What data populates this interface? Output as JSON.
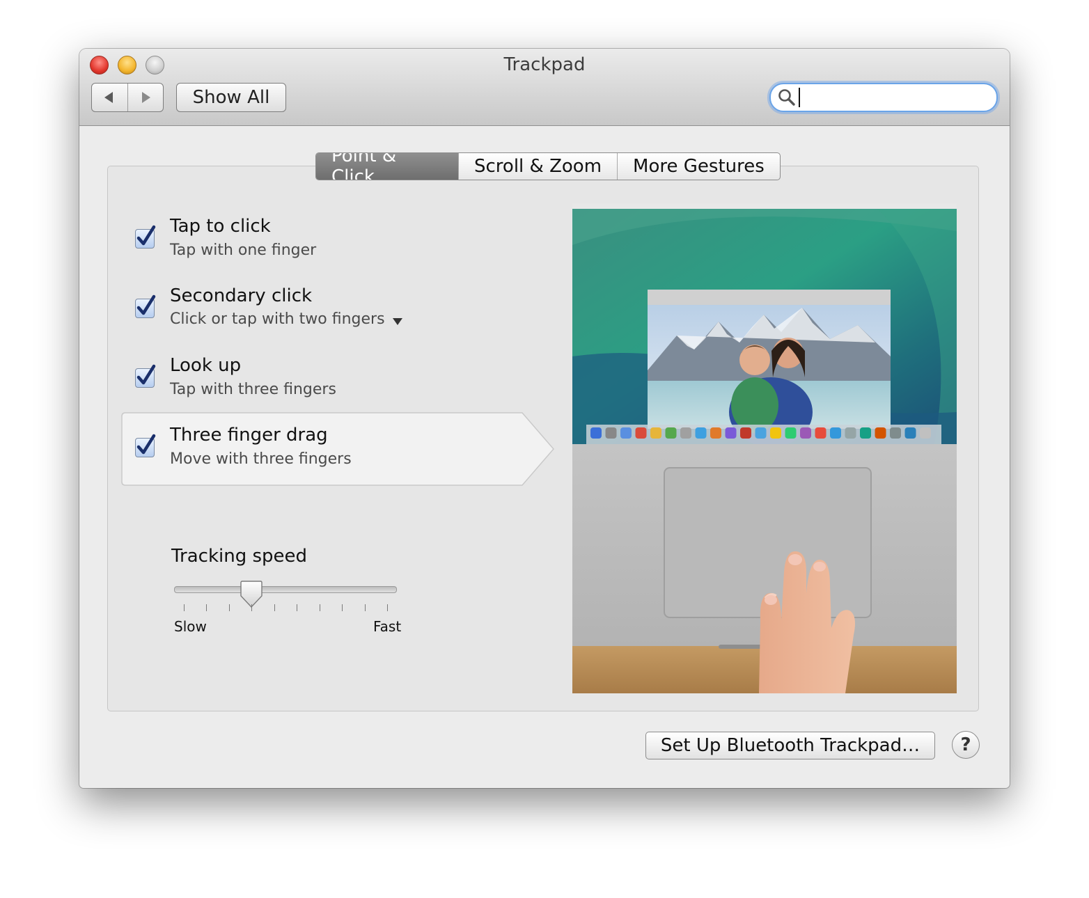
{
  "window": {
    "title": "Trackpad"
  },
  "toolbar": {
    "back_icon": "triangle-left-icon",
    "forward_icon": "triangle-right-icon",
    "show_all_label": "Show All",
    "search": {
      "value": "",
      "placeholder": "",
      "icon": "magnifier-icon"
    }
  },
  "tabs": [
    {
      "label": "Point & Click",
      "active": true
    },
    {
      "label": "Scroll & Zoom",
      "active": false
    },
    {
      "label": "More Gestures",
      "active": false
    }
  ],
  "options": [
    {
      "title": "Tap to click",
      "subtitle": "Tap with one finger",
      "checked": true
    },
    {
      "title": "Secondary click",
      "subtitle": "Click or tap with two fingers",
      "checked": true,
      "has_dropdown": true
    },
    {
      "title": "Look up",
      "subtitle": "Tap with three fingers",
      "checked": true
    },
    {
      "title": "Three finger drag",
      "subtitle": "Move with three fingers",
      "checked": true,
      "selected": true
    }
  ],
  "tracking": {
    "label": "Tracking speed",
    "slow_label": "Slow",
    "fast_label": "Fast",
    "tick_count": 10,
    "value_fraction": 0.35
  },
  "footer": {
    "setup_label": "Set Up Bluetooth Trackpad…",
    "help_label": "?"
  },
  "colors": {
    "accent": "#6aa4e8",
    "check": "#1a2f6b",
    "active_tab": "#7e7e7e"
  }
}
